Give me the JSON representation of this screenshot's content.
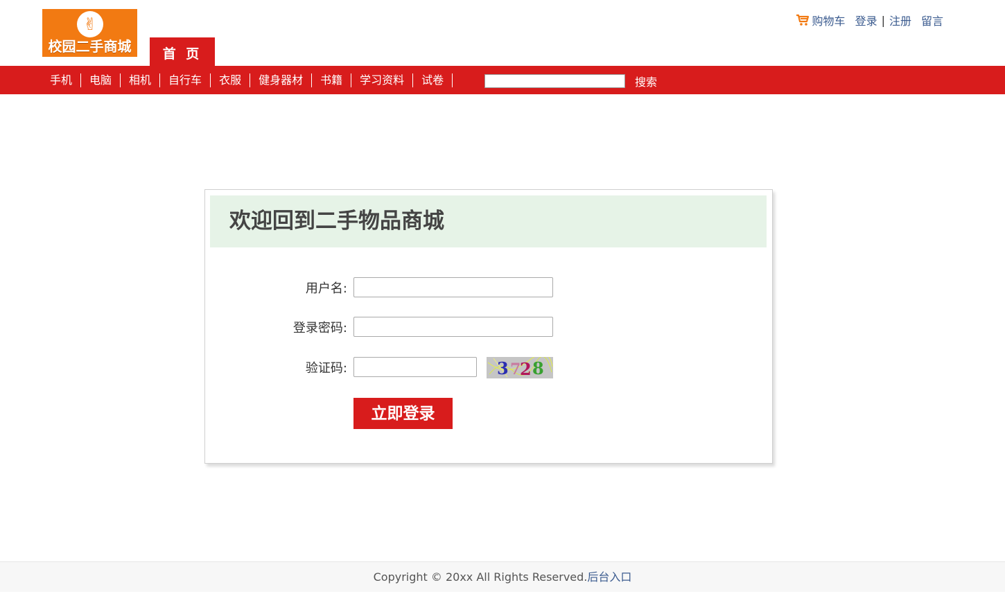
{
  "header": {
    "logo_text": "校园二手商城",
    "home_tab": "首 页",
    "links": {
      "cart": "购物车",
      "login": "登录",
      "separator": "|",
      "register": "注册",
      "message": "留言"
    }
  },
  "nav": {
    "items": [
      "手机",
      "电脑",
      "相机",
      "自行车",
      "衣服",
      "健身器材",
      "书籍",
      "学习资料",
      "试卷"
    ],
    "search_value": "",
    "search_button": "搜索"
  },
  "login": {
    "title": "欢迎回到二手物品商城",
    "username_label": "用户名:",
    "username_value": "",
    "password_label": "登录密码:",
    "password_value": "",
    "captcha_label": "验证码:",
    "captcha_value": "",
    "captcha_code": "3728",
    "submit_label": "立即登录"
  },
  "footer": {
    "copyright": "Copyright © 20xx All Rights Reserved.",
    "admin_link": "后台入口"
  },
  "colors": {
    "brand_red": "#d81c1c",
    "logo_orange": "#f27a12",
    "link_blue": "#3b5b8f",
    "header_green": "#e6f3e7"
  }
}
